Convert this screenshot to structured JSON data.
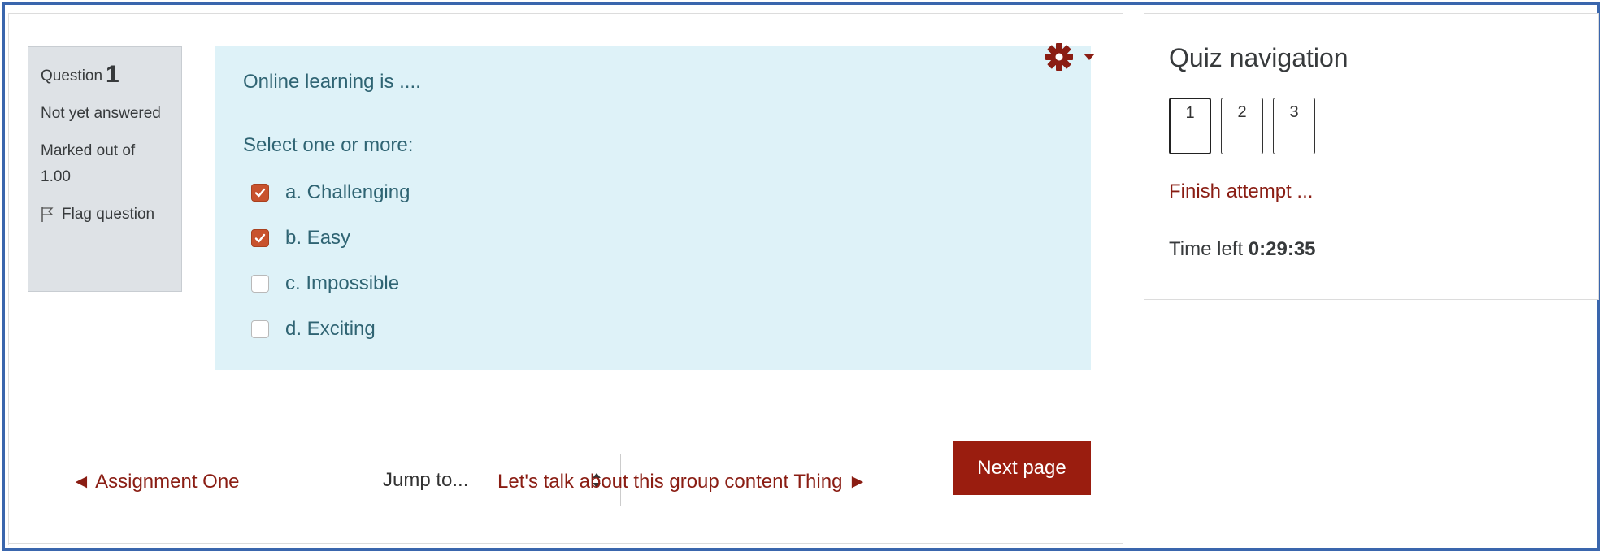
{
  "info": {
    "question_label": "Question",
    "question_number": "1",
    "status": "Not yet answered",
    "marks": "Marked out of 1.00",
    "flag": "Flag question"
  },
  "question": {
    "text": "Online learning is ....",
    "prompt": "Select one or more:",
    "options": [
      {
        "label": "a. Challenging",
        "checked": true
      },
      {
        "label": "b. Easy",
        "checked": true
      },
      {
        "label": "c. Impossible",
        "checked": false
      },
      {
        "label": "d. Exciting",
        "checked": false
      }
    ]
  },
  "navigation": {
    "prev_link": "◄ Assignment One",
    "jump_label": "Jump to...",
    "next_link": "Let's talk about this group content Thing ►",
    "next_button": "Next page"
  },
  "quiz_nav": {
    "title": "Quiz navigation",
    "questions": [
      "1",
      "2",
      "3"
    ],
    "current": "1",
    "finish": "Finish attempt ...",
    "time_label": "Time left",
    "time_value": "0:29:35"
  },
  "colors": {
    "accent": "#9a1d0f",
    "link": "#8a1d13",
    "question_bg": "#def2f8",
    "checkbox_checked": "#c8522d",
    "frame_border": "#3a66ad"
  },
  "icons": {
    "settings": "gear-icon",
    "flag": "flag-icon",
    "dropdown": "caret-down-icon",
    "select_arrows": "select-arrows-icon"
  }
}
